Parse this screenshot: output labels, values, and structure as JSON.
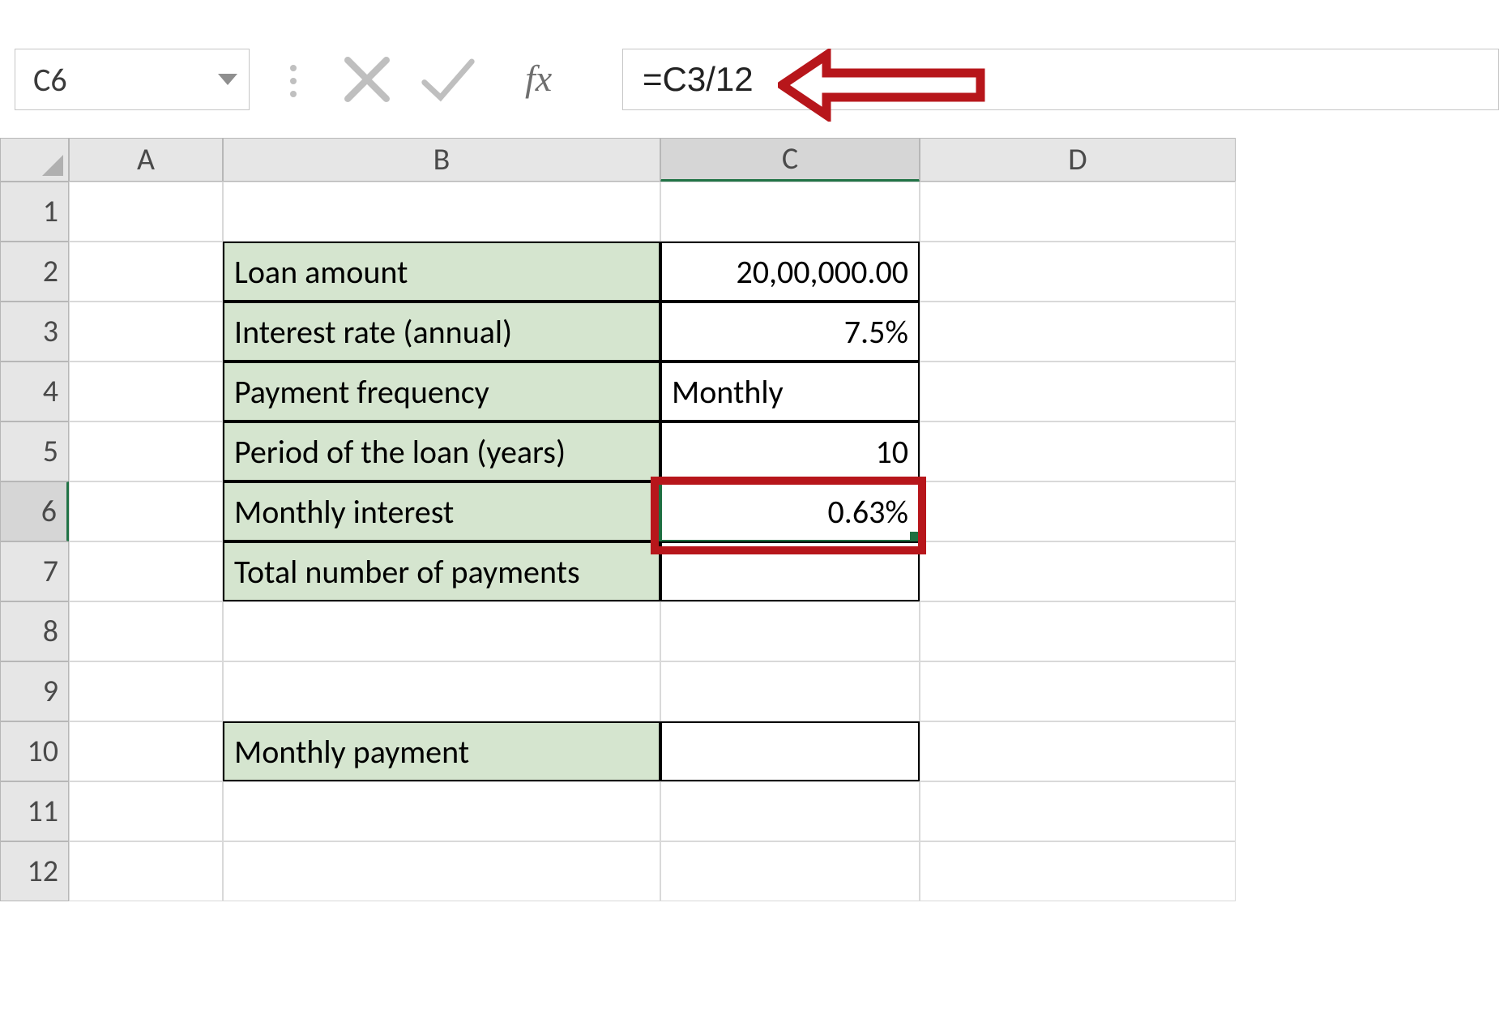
{
  "name_box": "C6",
  "formula_bar": "=C3/12",
  "fx_label": "fx",
  "columns": [
    "A",
    "B",
    "C",
    "D"
  ],
  "rows": [
    "1",
    "2",
    "3",
    "4",
    "5",
    "6",
    "7",
    "8",
    "9",
    "10",
    "11",
    "12"
  ],
  "labels": {
    "r2": "Loan amount",
    "r3": "Interest rate (annual)",
    "r4": "Payment frequency",
    "r5": "Period of the loan (years)",
    "r6": "Monthly interest",
    "r7": "Total number of payments",
    "r10": "Monthly payment"
  },
  "values": {
    "r2": "20,00,000.00",
    "r3": "7.5%",
    "r4": "Monthly",
    "r5": "10",
    "r6": "0.63%",
    "r7": "",
    "r10": ""
  },
  "active_cell": {
    "row": 6,
    "col": "C"
  },
  "annotation": {
    "arrow_target": "formula_bar",
    "highlight_cell": "C6"
  }
}
